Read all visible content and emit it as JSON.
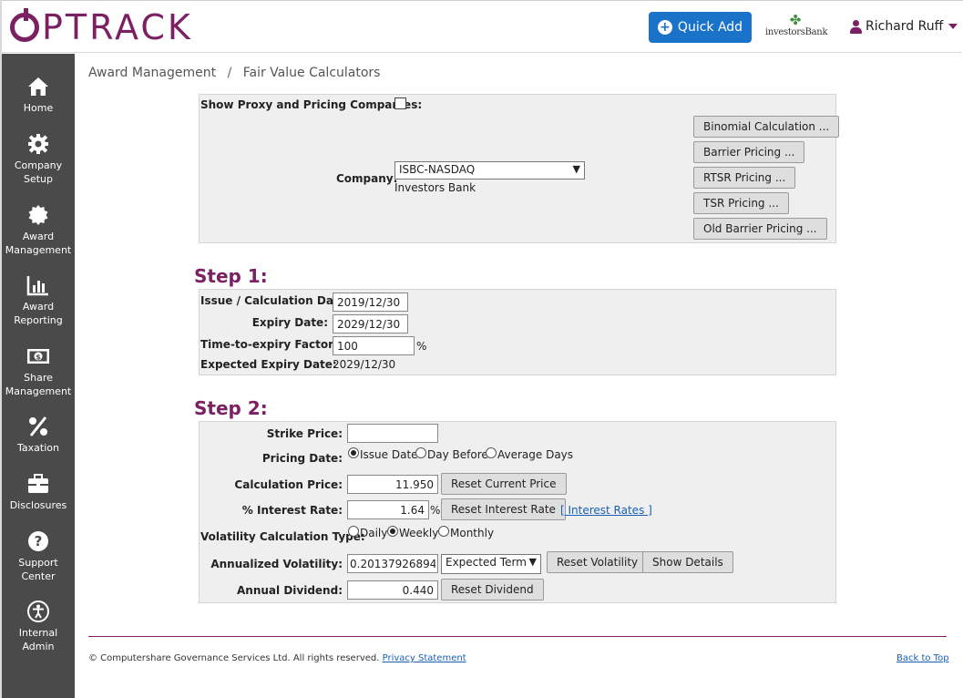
{
  "header": {
    "logo_text": "PTRACK",
    "quick_add_label": "Quick Add",
    "client_logo_text": "investorsBank",
    "user_name": "Richard Ruff"
  },
  "sidebar": {
    "items": [
      {
        "label": "Home",
        "icon": "home-icon"
      },
      {
        "label": "Company Setup",
        "icon": "gear-icon"
      },
      {
        "label": "Award Management",
        "icon": "badge-icon"
      },
      {
        "label": "Award Reporting",
        "icon": "bar-chart-icon"
      },
      {
        "label": "Share Management",
        "icon": "money-icon"
      },
      {
        "label": "Taxation",
        "icon": "percent-icon"
      },
      {
        "label": "Disclosures",
        "icon": "briefcase-icon"
      },
      {
        "label": "Support Center",
        "icon": "question-icon"
      },
      {
        "label": "Internal Admin",
        "icon": "accessibility-icon"
      }
    ]
  },
  "breadcrumb": {
    "parent": "Award Management",
    "separator": "/",
    "current": "Fair Value Calculators"
  },
  "company_panel": {
    "show_proxy_label": "Show Proxy and Pricing Companies:",
    "show_proxy_checked": false,
    "company_label": "Company:",
    "company_selected": "ISBC-NASDAQ",
    "company_name": "Investors Bank",
    "buttons": [
      "Binomial Calculation ...",
      "Barrier Pricing ...",
      "RTSR Pricing ...",
      "TSR Pricing ...",
      "Old Barrier Pricing ..."
    ]
  },
  "step1": {
    "title": "Step 1:",
    "issue_date_label": "Issue / Calculation Date:",
    "issue_date_value": "2019/12/30",
    "expiry_date_label": "Expiry Date:",
    "expiry_date_value": "2029/12/30",
    "time_factor_label": "Time-to-expiry Factor:",
    "time_factor_value": "100",
    "time_factor_unit": "%",
    "expected_expiry_label": "Expected Expiry Date:",
    "expected_expiry_value": "2029/12/30"
  },
  "step2": {
    "title": "Step 2:",
    "strike_price_label": "Strike Price:",
    "strike_price_value": "",
    "pricing_date_label": "Pricing Date:",
    "pricing_date_options": [
      "Issue Date",
      "Day Before",
      "Average Days"
    ],
    "pricing_date_selected": "Issue Date",
    "calc_price_label": "Calculation Price:",
    "calc_price_value": "11.950",
    "reset_current_price": "Reset Current Price",
    "interest_rate_label": "% Interest Rate:",
    "interest_rate_value": "1.64",
    "interest_rate_unit": "%",
    "reset_interest_rate": "Reset Interest Rate",
    "interest_rates_link": "[ Interest Rates ]",
    "volatility_type_label": "Volatility Calculation Type:",
    "volatility_type_options": [
      "Daily",
      "Weekly",
      "Monthly"
    ],
    "volatility_type_selected": "Weekly",
    "annualized_volatility_label": "Annualized Volatility:",
    "annualized_volatility_value": "0.201379268945",
    "volatility_term_selected": "Expected Term",
    "reset_volatility": "Reset Volatility",
    "show_details": "Show Details",
    "annual_dividend_label": "Annual Dividend:",
    "annual_dividend_value": "0.440",
    "reset_dividend": "Reset Dividend"
  },
  "footer": {
    "copyright": "© Computershare Governance Services Ltd. All rights reserved.",
    "privacy_link": "Privacy Statement",
    "back_to_top": "Back to Top"
  },
  "colors": {
    "brand": "#7b2163",
    "quick_add": "#1a73c9",
    "sidebar": "#4a4a4a",
    "link": "#1a5fb4"
  }
}
